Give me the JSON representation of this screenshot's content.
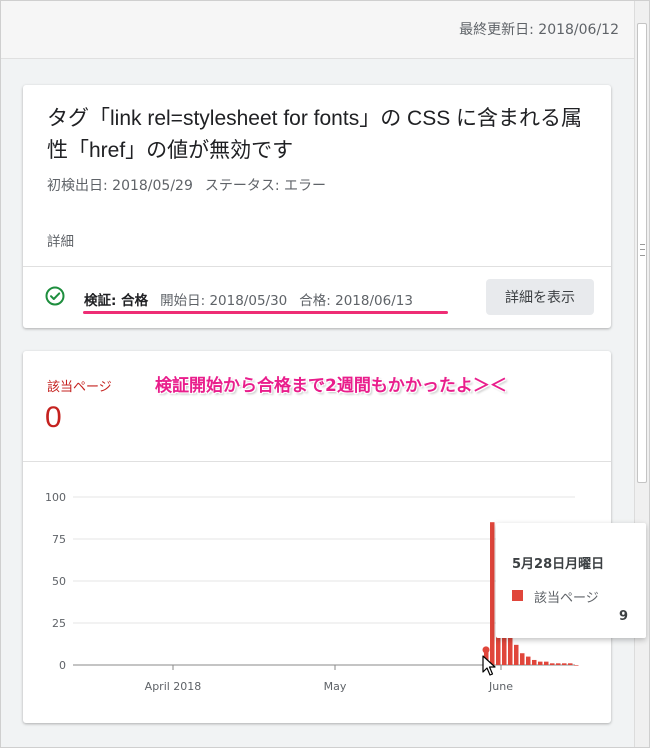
{
  "header": {
    "last_updated": "最終更新日: 2018/06/12"
  },
  "issue": {
    "title": "タグ「link rel=stylesheet for fonts」の CSS に含まれる属性「href」の値が無効です",
    "first_detected_label": "初検出日: ",
    "first_detected": "2018/05/29",
    "status_label": "ステータス: ",
    "status": "エラー",
    "details_label": "詳細"
  },
  "validation": {
    "label": "検証: 合格",
    "started": "開始日: 2018/05/30",
    "passed": "合格: 2018/06/13",
    "button": "詳細を表示",
    "status_icon": "check-circle-icon",
    "status_color": "#1e8e3e",
    "highlight_color": "#ee2d75"
  },
  "metric": {
    "label": "該当ページ",
    "value": "0",
    "color": "#c5221f"
  },
  "annotation": "検証開始から合格まで2週間もかかったよ＞＜",
  "tooltip": {
    "date": "5月28日月曜日",
    "series": "該当ページ",
    "value": "9"
  },
  "chart_data": {
    "type": "bar",
    "x_ticks": [
      "April 2018",
      "May",
      "June"
    ],
    "y_ticks": [
      "100",
      "75",
      "50",
      "25",
      "0"
    ],
    "ylim": [
      0,
      100
    ],
    "grid": true,
    "color": "#e0463b",
    "series": [
      {
        "values": [
          9,
          85,
          62,
          38,
          20,
          12,
          7,
          5,
          3,
          2,
          2,
          1,
          1,
          1,
          1,
          0
        ]
      }
    ]
  }
}
